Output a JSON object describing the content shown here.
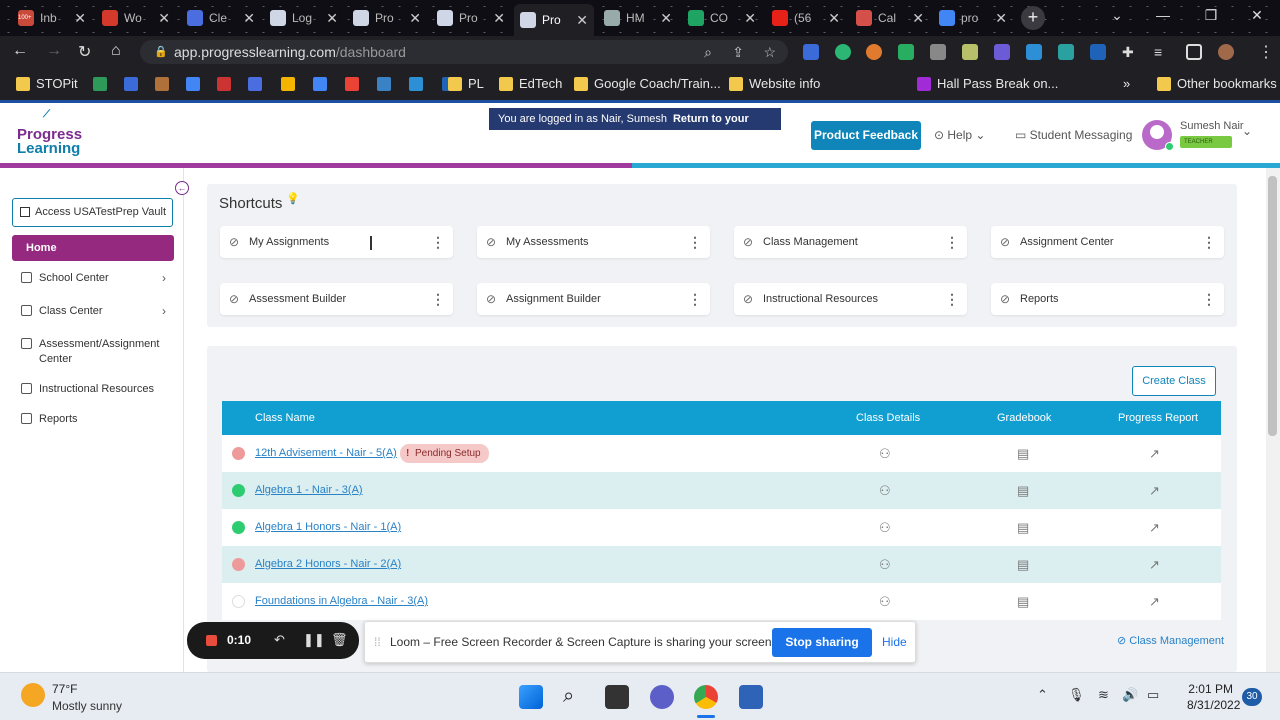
{
  "browser": {
    "tabs": [
      {
        "label": "Inb",
        "color": "#c94a3a",
        "badge": "100+"
      },
      {
        "label": "Wo",
        "color": "#d33a2c"
      },
      {
        "label": "Cle",
        "color": "#4a6ee0"
      },
      {
        "label": "Log",
        "color": "#cfd6e6"
      },
      {
        "label": "Pro",
        "color": "#cfd6e6"
      },
      {
        "label": "Pro",
        "color": "#cfd6e6"
      },
      {
        "label": "Pro",
        "color": "#cfd6e6"
      },
      {
        "label": "HM",
        "color": "#9aa"
      },
      {
        "label": "CO",
        "color": "#1fa463"
      },
      {
        "label": "(56",
        "color": "#e62117"
      },
      {
        "label": "Cal",
        "color": "#d5504b"
      },
      {
        "label": "pro",
        "color": "#4285f4"
      }
    ],
    "url_domain": "app.progresslearning.com",
    "url_path": "/dashboard",
    "bookmarks": [
      {
        "label": "STOPit",
        "color": "#f2c94c"
      },
      {
        "label": "PL",
        "color": "#f2c94c"
      },
      {
        "label": "EdTech",
        "color": "#f2c94c"
      },
      {
        "label": "Google Coach/Train...",
        "color": "#f2c94c"
      },
      {
        "label": "Website info",
        "color": "#f2c94c"
      },
      {
        "label": "Hall Pass Break on...",
        "color": "#a12bd6"
      },
      {
        "label": "Other bookmarks",
        "color": "#f2c94c"
      }
    ],
    "overflow_chevron": "»"
  },
  "header": {
    "logo_line1": "Progress",
    "logo_line2": "Learning",
    "banner_text": "You are logged in as Nair, Sumesh",
    "banner_link": "Return to your account",
    "feedback_button": "Product Feedback",
    "help_label": "Help",
    "messaging_label": "Student Messaging",
    "user_name": "Sumesh Nair",
    "user_role": "TEACHER"
  },
  "sidebar": {
    "vault_button": "Access USATestPrep Vault",
    "items": [
      {
        "label": "Home",
        "active": true
      },
      {
        "label": "School Center",
        "chevron": true
      },
      {
        "label": "Class Center",
        "chevron": true
      },
      {
        "label": "Assessment/Assignment Center"
      },
      {
        "label": "Instructional Resources"
      },
      {
        "label": "Reports"
      }
    ]
  },
  "shortcuts": {
    "title": "Shortcuts",
    "cards": [
      "My Assignments",
      "My Assessments",
      "Class Management",
      "Assignment Center",
      "Assessment Builder",
      "Assignment Builder",
      "Instructional Resources",
      "Reports"
    ]
  },
  "classes": {
    "create_button": "Create Class",
    "columns": [
      "Class Name",
      "Class Details",
      "Gradebook",
      "Progress Report"
    ],
    "rows": [
      {
        "name": "12th Advisement - Nair - 5(A)",
        "status_color": "#ef9a9a",
        "badge": "Pending Setup"
      },
      {
        "name": "Algebra 1 - Nair - 3(A)",
        "status_color": "#2ecc71"
      },
      {
        "name": "Algebra 1 Honors - Nair - 1(A)",
        "status_color": "#2ecc71"
      },
      {
        "name": "Algebra 2 Honors - Nair - 2(A)",
        "status_color": "#ef9a9a"
      },
      {
        "name": "Foundations in Algebra - Nair - 3(A)",
        "status_color": "#ffffff"
      }
    ],
    "footer_link": "Class Management"
  },
  "recorder": {
    "time": "0:10"
  },
  "loom": {
    "message": "Loom – Free Screen Recorder & Screen Capture is sharing your screen.",
    "stop_button": "Stop sharing",
    "hide_button": "Hide"
  },
  "taskbar": {
    "temperature": "77°F",
    "condition": "Mostly sunny",
    "time": "2:01 PM",
    "date": "8/31/2022",
    "notifications": "30"
  }
}
